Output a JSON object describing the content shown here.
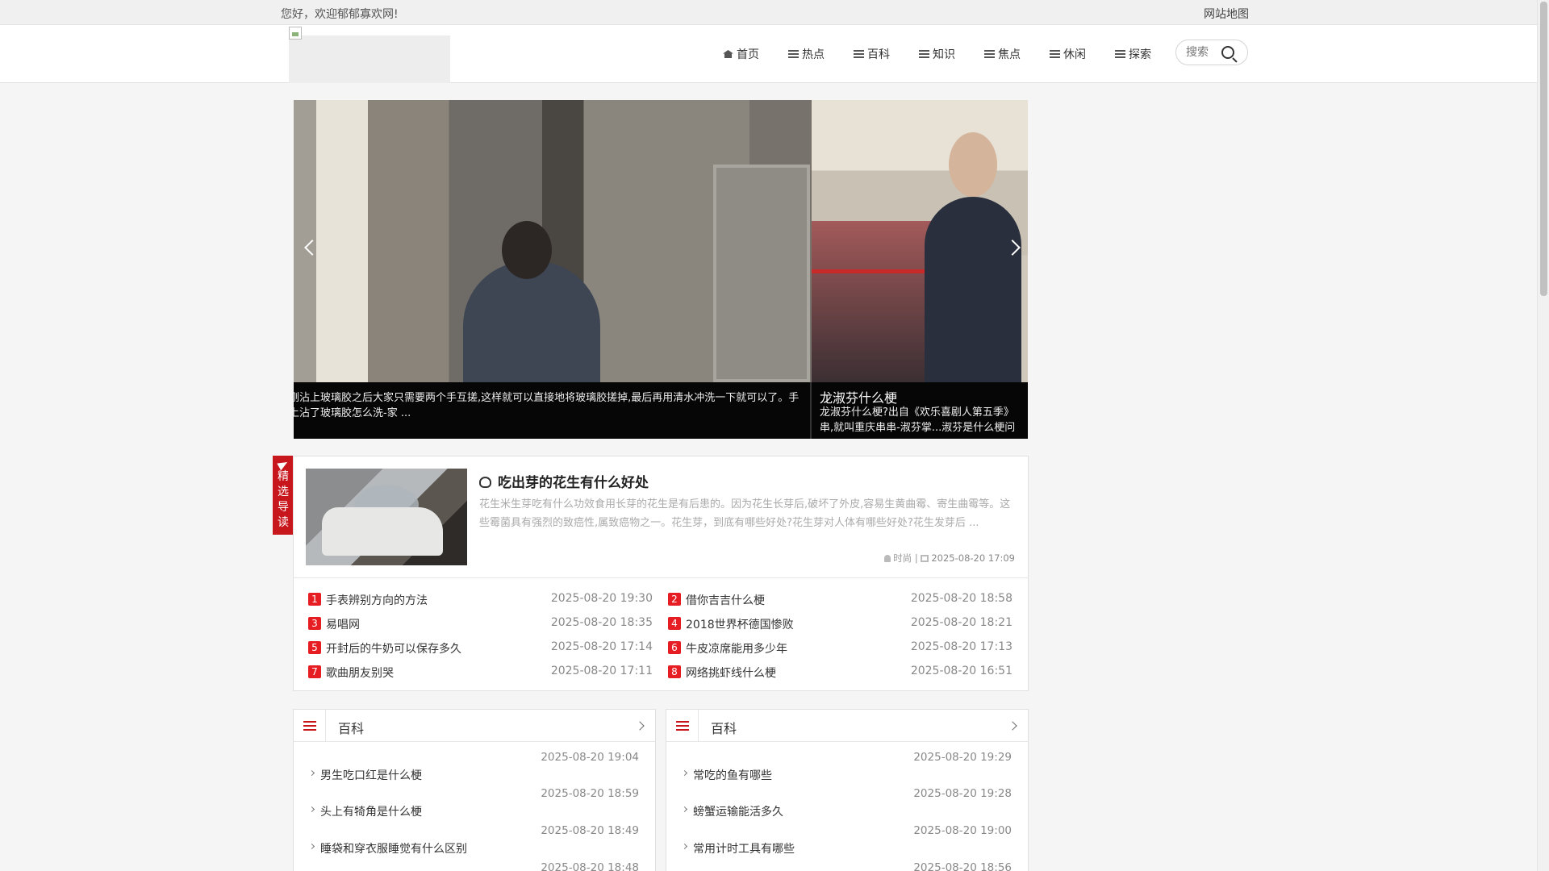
{
  "topbar": {
    "welcome": "您好，欢迎郁郁寡欢网!",
    "sitemap": "网站地图"
  },
  "nav": [
    {
      "label": "首页",
      "icon": "home-icon"
    },
    {
      "label": "热点",
      "icon": "list-icon"
    },
    {
      "label": "百科",
      "icon": "list-icon"
    },
    {
      "label": "知识",
      "icon": "list-icon"
    },
    {
      "label": "焦点",
      "icon": "list-icon"
    },
    {
      "label": "休闲",
      "icon": "list-icon"
    },
    {
      "label": "探索",
      "icon": "list-icon"
    }
  ],
  "search": {
    "placeholder": "搜索"
  },
  "slider": {
    "slide1": {
      "desc": "刚沾上玻璃胶之后大家只需要两个手互搓,这样就可以直接地将玻璃胶搓掉,最后再用清水冲洗一下就可以了。手上沾了玻璃胶怎么洗-家 ..."
    },
    "slide2": {
      "title": "龙淑芬什么梗",
      "desc": "龙淑芬什么梗?出自《欢乐喜剧人第五季》串,就叫重庆串串-淑芬掌...淑芬是什么梗问"
    }
  },
  "featured": {
    "ribbon": [
      "精",
      "选",
      "导",
      "读"
    ],
    "title": "吃出芽的花生有什么好处",
    "desc": "花生米生芽吃有什么功效食用长芽的花生是有后患的。因为花生长芽后,破坏了外皮,容易生黄曲霉、寄生曲霉等。这些霉菌具有强烈的致癌性,属致癌物之一。花生芽，到底有哪些好处?花生芽对人体有哪些好处?花生发芽后 ...",
    "author": "时尚",
    "date": "2025-08-20 17:09"
  },
  "hot_list": [
    {
      "num": "1",
      "title": "手表辨别方向的方法",
      "date": "2025-08-20 19:30"
    },
    {
      "num": "2",
      "title": "借你吉吉什么梗",
      "date": "2025-08-20 18:58"
    },
    {
      "num": "3",
      "title": "易唱网",
      "date": "2025-08-20 18:35"
    },
    {
      "num": "4",
      "title": "2018世界杯德国惨败",
      "date": "2025-08-20 18:21"
    },
    {
      "num": "5",
      "title": "开封后的牛奶可以保存多久",
      "date": "2025-08-20 17:14"
    },
    {
      "num": "6",
      "title": "牛皮凉席能用多少年",
      "date": "2025-08-20 17:13"
    },
    {
      "num": "7",
      "title": "歌曲朋友别哭",
      "date": "2025-08-20 17:11"
    },
    {
      "num": "8",
      "title": "网络挑虾线什么梗",
      "date": "2025-08-20 16:51"
    }
  ],
  "panels": [
    {
      "name": "百科",
      "items": [
        {
          "date": "2025-08-20 19:04",
          "title": "男生吃口红是什么梗"
        },
        {
          "date": "2025-08-20 18:59",
          "title": "头上有犄角是什么梗"
        },
        {
          "date": "2025-08-20 18:49",
          "title": "睡袋和穿衣服睡觉有什么区别"
        },
        {
          "date": "2025-08-20 18:48",
          "title": ""
        }
      ]
    },
    {
      "name": "百科",
      "items": [
        {
          "date": "2025-08-20 19:29",
          "title": "常吃的鱼有哪些"
        },
        {
          "date": "2025-08-20 19:28",
          "title": "螃蟹运输能活多久"
        },
        {
          "date": "2025-08-20 19:00",
          "title": "常用计时工具有哪些"
        },
        {
          "date": "2025-08-20 18:56",
          "title": ""
        }
      ]
    }
  ]
}
